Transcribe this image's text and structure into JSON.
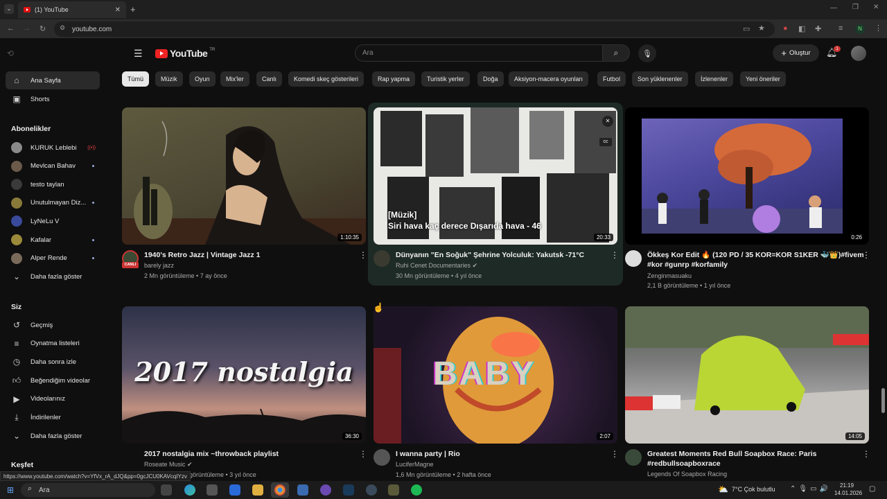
{
  "browser": {
    "tab_title": "(1) YouTube",
    "url": "youtube.com",
    "profile_initial": "N",
    "status_url": "https://www.youtube.com/watch?v=YfVx_rA_dJQ&pp=0gcJCU0KAVcqIYzv"
  },
  "header": {
    "logo_text": "YouTube",
    "logo_suffix": "TR",
    "search_placeholder": "Ara",
    "create_label": "Oluştur",
    "notification_count": "1"
  },
  "chips": [
    "Tümü",
    "Müzik",
    "Oyun",
    "Mix'ler",
    "Canlı",
    "Komedi skeç gösterileri",
    "Rap yapma",
    "Turistik yerler",
    "Doğa",
    "Aksiyon-macera oyunları",
    "Futbol",
    "Son yüklenenler",
    "İzlenenler",
    "Yeni öneriler"
  ],
  "sidebar": {
    "main": [
      {
        "label": "Ana Sayfa",
        "icon": "home-icon"
      },
      {
        "label": "Shorts",
        "icon": "shorts-icon"
      }
    ],
    "subscriptions_heading": "Abonelikler",
    "subscriptions": [
      {
        "label": "KURUK Leblebi",
        "color": "#8a8a8a",
        "badge": "live"
      },
      {
        "label": "Mevlcan Bahav",
        "color": "#6b5a4a",
        "badge": "dot"
      },
      {
        "label": "testo taylan",
        "color": "#3a3a3a",
        "badge": ""
      },
      {
        "label": "Unutulmayan Diz...",
        "color": "#8a7a3a",
        "badge": "dot"
      },
      {
        "label": "LyNeLu V",
        "color": "#3a4a9a",
        "badge": ""
      },
      {
        "label": "Kafalar",
        "color": "#9a8a3a",
        "badge": "dot"
      },
      {
        "label": "Alper Rende",
        "color": "#7a6a5a",
        "badge": "dot"
      }
    ],
    "show_more": "Daha fazla göster",
    "you_heading": "Siz",
    "you_items": [
      {
        "label": "Geçmiş",
        "icon": "history-icon"
      },
      {
        "label": "Oynatma listeleri",
        "icon": "playlist-icon"
      },
      {
        "label": "Daha sonra izle",
        "icon": "clock-icon"
      },
      {
        "label": "Beğendiğim videolar",
        "icon": "thumbs-up-icon"
      },
      {
        "label": "Videolarınız",
        "icon": "video-icon"
      },
      {
        "label": "İndirilenler",
        "icon": "download-icon"
      },
      {
        "label": "Daha fazla göster",
        "icon": "chevron-down-icon"
      }
    ],
    "explore_heading": "Keşfet"
  },
  "videos": [
    {
      "title": "1940's Retro Jazz | Vintage Jazz 1",
      "channel": "barely jazz",
      "meta": "2 Mn görüntüleme • 7 ay önce",
      "duration": "1:10:35",
      "live_badge": "CANLI"
    },
    {
      "title": "Dünyanın \"En Soğuk\" Şehrine Yolculuk: Yakutsk -71°C",
      "channel": "Ruhi Cenet Documentaries",
      "meta": "30 Mn görüntüleme • 4 yıl önce",
      "duration": "20:33",
      "overlay_tag": "[Müzik]",
      "overlay_caption": "Siri hava kaç derece Dışarıda hava - 46"
    },
    {
      "title": "Ökkeş Kor Edit 🔥 (120 PD / 35 KOR=KOR S1KER 🐳👑)#fivem",
      "title2": "#kor #gunrp #korfamily",
      "channel": "Zenginmasuaku",
      "meta": "2,1 B görüntüleme • 1 yıl önce",
      "duration": "0:26"
    },
    {
      "title": "2017 nostalgia mix ~throwback playlist",
      "channel": "Roseate Music",
      "meta": "Mn görüntüleme • 3 yıl önce",
      "duration": "36:30",
      "thumb_text": "2017 nostalgia"
    },
    {
      "title": "I wanna party | Rio",
      "channel": "LuciferMagne",
      "meta": "1,6 Mn görüntüleme • 2 hafta önce",
      "duration": "2:07",
      "thumb_text": "BABY"
    },
    {
      "title": "Greatest Moments Red Bull Soapbox Race: Paris",
      "title2": "#redbullsoapboxrace",
      "channel": "Legends Of Soapbox Racing",
      "meta": "",
      "duration": "14:05"
    }
  ],
  "taskbar": {
    "search_label": "Ara",
    "weather": "7°C  Çok bulutlu",
    "time": "21:19",
    "date": "14.01.2026"
  }
}
